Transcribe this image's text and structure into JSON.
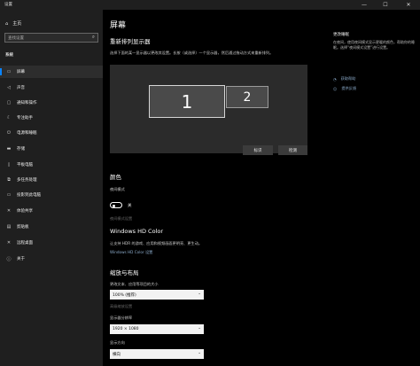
{
  "window": {
    "title": "设置",
    "minimize": "—",
    "maximize": "☐",
    "close": "✕"
  },
  "sidebar": {
    "home_label": "主页",
    "search_placeholder": "查找设置",
    "section_title": "系统",
    "items": [
      {
        "label": "屏幕",
        "icon": "display-icon",
        "active": true
      },
      {
        "label": "声音",
        "icon": "speaker-icon"
      },
      {
        "label": "通知和操作",
        "icon": "notification-icon"
      },
      {
        "label": "专注助手",
        "icon": "moon-icon"
      },
      {
        "label": "电源和睡眠",
        "icon": "power-icon"
      },
      {
        "label": "存储",
        "icon": "storage-icon"
      },
      {
        "label": "平板电脑",
        "icon": "tablet-icon"
      },
      {
        "label": "多任务处理",
        "icon": "multitask-icon"
      },
      {
        "label": "投影到此电脑",
        "icon": "project-icon"
      },
      {
        "label": "体验共享",
        "icon": "share-icon"
      },
      {
        "label": "剪贴板",
        "icon": "clipboard-icon"
      },
      {
        "label": "远程桌面",
        "icon": "remote-icon"
      },
      {
        "label": "关于",
        "icon": "info-icon"
      }
    ]
  },
  "main": {
    "title": "屏幕",
    "arrange_heading": "重新排列显示器",
    "arrange_desc": "选择下面的某一显示器以更改其设置。长按（或选择）一个显示器，然后通过拖动方式来重新排列。",
    "monitor1": "1",
    "monitor2": "2",
    "identify": "标识",
    "detect": "检测",
    "color_heading": "颜色",
    "night_light_label": "夜间模式",
    "night_light_state": "关",
    "night_light_settings": "夜间模式设置",
    "hdr_heading": "Windows HD Color",
    "hdr_desc": "让支持 HDR 的游戏、应用和视频画面更明亮、更生动。",
    "hdr_link": "Windows HD Color 设置",
    "scale_heading": "缩放与布局",
    "scale_label": "更改文本、应用等项目的大小",
    "scale_value": "100% (推荐)",
    "advanced_scale": "高级缩放设置",
    "resolution_label": "显示器分辨率",
    "resolution_value": "1920 × 1080",
    "orientation_label": "显示方向",
    "orientation_value": "横向"
  },
  "right_panel": {
    "title": "更改睡眠",
    "desc": "在夜间，使用夜间模式显示更暖的颜色，帮助你的睡眠。选择“夜间模式设置”进行设置。",
    "help_link": "获取帮助",
    "feedback_link": "提供反馈"
  }
}
